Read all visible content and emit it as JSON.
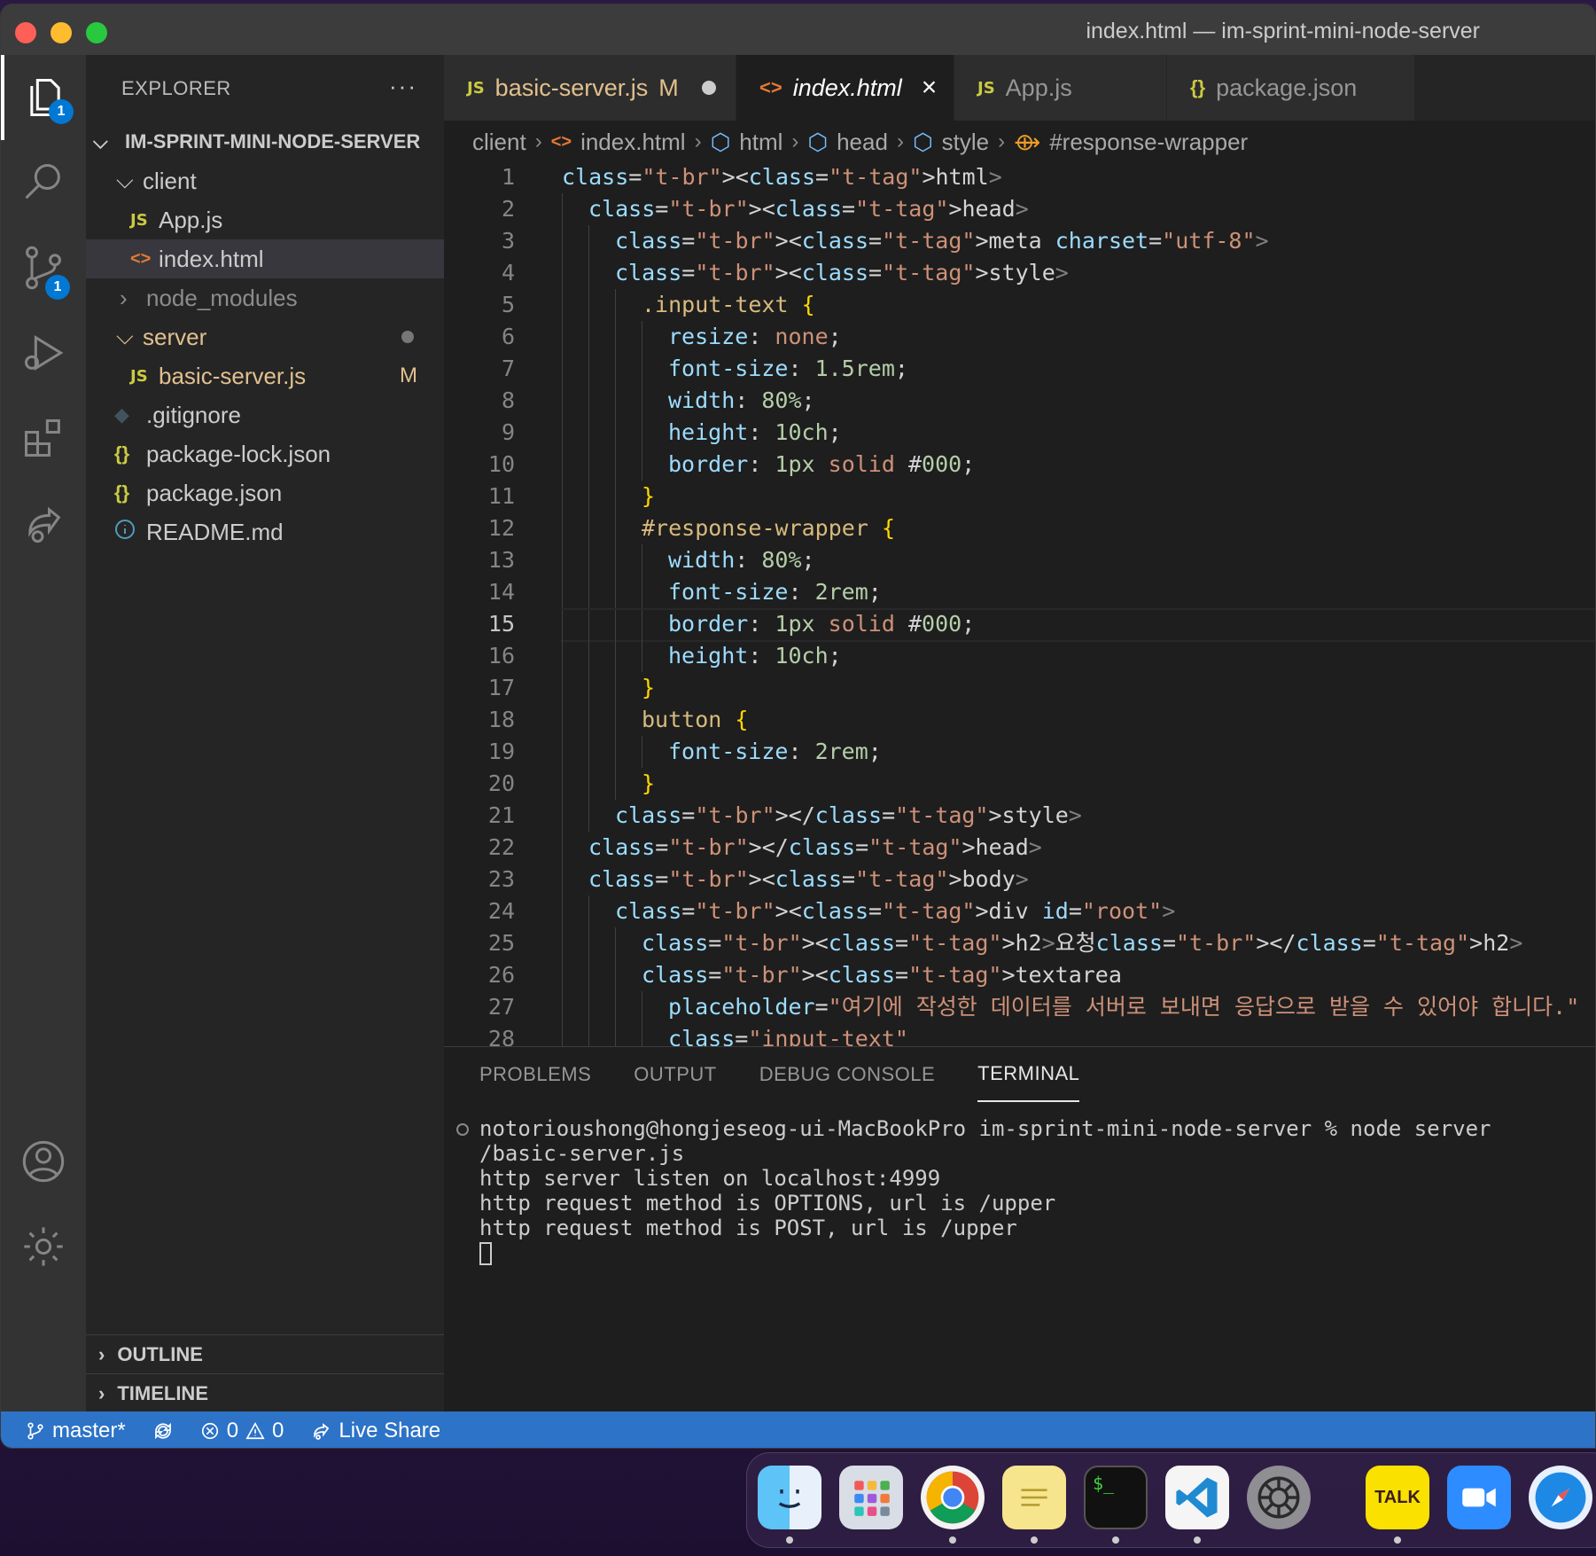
{
  "window": {
    "title": "index.html — im-sprint-mini-node-server"
  },
  "activity_bar": {
    "explorer_badge": "1",
    "scm_badge": "1"
  },
  "sidebar": {
    "header": "EXPLORER",
    "more": "···",
    "root": "IM-SPRINT-MINI-NODE-SERVER",
    "items": [
      {
        "label": "client",
        "kind": "folder-open"
      },
      {
        "label": "App.js",
        "kind": "js"
      },
      {
        "label": "index.html",
        "kind": "html"
      },
      {
        "label": "node_modules",
        "kind": "folder-closed"
      },
      {
        "label": "server",
        "kind": "folder-open"
      },
      {
        "label": "basic-server.js",
        "kind": "js",
        "decoration": "M"
      },
      {
        "label": ".gitignore",
        "kind": "git"
      },
      {
        "label": "package-lock.json",
        "kind": "json"
      },
      {
        "label": "package.json",
        "kind": "json"
      },
      {
        "label": "README.md",
        "kind": "info"
      }
    ],
    "outline": "OUTLINE",
    "timeline": "TIMELINE"
  },
  "tabs": [
    {
      "label": "basic-server.js",
      "icon": "JS",
      "status": "M"
    },
    {
      "label": "index.html",
      "icon": "<>"
    },
    {
      "label": "App.js",
      "icon": "JS"
    },
    {
      "label": "package.json",
      "icon": "{}"
    }
  ],
  "breadcrumb": [
    "client",
    "index.html",
    "html",
    "head",
    "style",
    "#response-wrapper"
  ],
  "editor": {
    "current_line": 15,
    "line_numbers": [
      "1",
      "2",
      "3",
      "4",
      "5",
      "6",
      "7",
      "8",
      "9",
      "10",
      "11",
      "12",
      "13",
      "14",
      "15",
      "16",
      "17",
      "18",
      "19",
      "20",
      "21",
      "22",
      "23",
      "24",
      "25",
      "26",
      "27",
      "28"
    ],
    "lines": [
      "<html>",
      "  <head>",
      "    <meta charset=\"utf-8\">",
      "    <style>",
      "      .input-text {",
      "        resize: none;",
      "        font-size: 1.5rem;",
      "        width: 80%;",
      "        height: 10ch;",
      "        border: 1px solid #000;",
      "      }",
      "      #response-wrapper {",
      "        width: 80%;",
      "        font-size: 2rem;",
      "        border: 1px solid #000;",
      "        height: 10ch;",
      "      }",
      "      button {",
      "        font-size: 2rem;",
      "      }",
      "    </style>",
      "  </head>",
      "  <body>",
      "    <div id=\"root\">",
      "      <h2>요청</h2>",
      "      <textarea",
      "        placeholder=\"여기에 작성한 데이터를 서버로 보내면 응답으로 받을 수 있어야 합니다.\"",
      "        class=\"input-text\""
    ]
  },
  "panel": {
    "tabs": [
      "PROBLEMS",
      "OUTPUT",
      "DEBUG CONSOLE",
      "TERMINAL"
    ],
    "active_tab": "TERMINAL",
    "terminal_lines": [
      "notorioushong@hongjeseog-ui-MacBookPro im-sprint-mini-node-server % node server",
      "/basic-server.js",
      "http server listen on localhost:4999",
      "http request method is OPTIONS, url is /upper",
      "http request method is POST, url is /upper"
    ]
  },
  "statusbar": {
    "branch": "master*",
    "errors": "0",
    "warnings": "0",
    "live_share": "Live Share"
  },
  "dock": {
    "apps": [
      "finder-icon",
      "launchpad-icon",
      "chrome-icon",
      "notes-icon",
      "terminal-icon",
      "vscode-icon",
      "system-settings-icon",
      "kakaotalk-icon",
      "zoom-icon",
      "safari-icon"
    ],
    "kakaotalk_label": "TALK",
    "terminal_label": "$_"
  },
  "colors": {
    "statusbar": "#2d73c7",
    "accent": "#0078d4"
  }
}
